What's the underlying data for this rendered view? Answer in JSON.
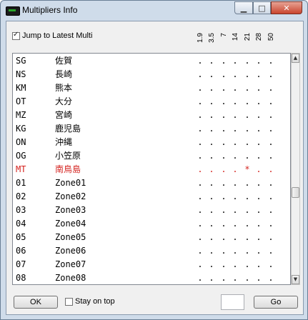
{
  "window": {
    "title": "Multipliers Info"
  },
  "options": {
    "jump_label": "Jump to Latest Multi",
    "jump_checked": true,
    "stay_label": "Stay on top",
    "stay_checked": false
  },
  "bands": [
    "1.9",
    "3.5",
    "7",
    "14",
    "21",
    "28",
    "50"
  ],
  "rows": [
    {
      "code": "SG",
      "name": "佐賀",
      "marks": [
        ".",
        ".",
        ".",
        ".",
        ".",
        ".",
        "."
      ],
      "highlight": false
    },
    {
      "code": "NS",
      "name": "長崎",
      "marks": [
        ".",
        ".",
        ".",
        ".",
        ".",
        ".",
        "."
      ],
      "highlight": false
    },
    {
      "code": "KM",
      "name": "熊本",
      "marks": [
        ".",
        ".",
        ".",
        ".",
        ".",
        ".",
        "."
      ],
      "highlight": false
    },
    {
      "code": "OT",
      "name": "大分",
      "marks": [
        ".",
        ".",
        ".",
        ".",
        ".",
        ".",
        "."
      ],
      "highlight": false
    },
    {
      "code": "MZ",
      "name": "宮崎",
      "marks": [
        ".",
        ".",
        ".",
        ".",
        ".",
        ".",
        "."
      ],
      "highlight": false
    },
    {
      "code": "KG",
      "name": "鹿児島",
      "marks": [
        ".",
        ".",
        ".",
        ".",
        ".",
        ".",
        "."
      ],
      "highlight": false
    },
    {
      "code": "ON",
      "name": "沖縄",
      "marks": [
        ".",
        ".",
        ".",
        ".",
        ".",
        ".",
        "."
      ],
      "highlight": false
    },
    {
      "code": "OG",
      "name": "小笠原",
      "marks": [
        ".",
        ".",
        ".",
        ".",
        ".",
        ".",
        "."
      ],
      "highlight": false
    },
    {
      "code": "MT",
      "name": "南鳥島",
      "marks": [
        ".",
        ".",
        ".",
        ".",
        "*",
        ".",
        "."
      ],
      "highlight": true
    },
    {
      "code": "01",
      "name": "Zone01",
      "marks": [
        ".",
        ".",
        ".",
        ".",
        ".",
        ".",
        "."
      ],
      "highlight": false
    },
    {
      "code": "02",
      "name": "Zone02",
      "marks": [
        ".",
        ".",
        ".",
        ".",
        ".",
        ".",
        "."
      ],
      "highlight": false
    },
    {
      "code": "03",
      "name": "Zone03",
      "marks": [
        ".",
        ".",
        ".",
        ".",
        ".",
        ".",
        "."
      ],
      "highlight": false
    },
    {
      "code": "04",
      "name": "Zone04",
      "marks": [
        ".",
        ".",
        ".",
        ".",
        ".",
        ".",
        "."
      ],
      "highlight": false
    },
    {
      "code": "05",
      "name": "Zone05",
      "marks": [
        ".",
        ".",
        ".",
        ".",
        ".",
        ".",
        "."
      ],
      "highlight": false
    },
    {
      "code": "06",
      "name": "Zone06",
      "marks": [
        ".",
        ".",
        ".",
        ".",
        ".",
        ".",
        "."
      ],
      "highlight": false
    },
    {
      "code": "07",
      "name": "Zone07",
      "marks": [
        ".",
        ".",
        ".",
        ".",
        ".",
        ".",
        "."
      ],
      "highlight": false
    },
    {
      "code": "08",
      "name": "Zone08",
      "marks": [
        ".",
        ".",
        ".",
        ".",
        ".",
        ".",
        "."
      ],
      "highlight": false
    }
  ],
  "buttons": {
    "ok": "OK",
    "go": "Go"
  },
  "go_input": {
    "value": ""
  },
  "colors": {
    "highlight": "#d4231f",
    "client_bg": "#f0f0f0"
  },
  "icons": {
    "app": "app-window-icon",
    "minimize": "minimize-icon",
    "maximize": "maximize-icon",
    "close": "close-icon",
    "scroll_up": "scroll-up-arrow-icon",
    "scroll_down": "scroll-down-arrow-icon"
  }
}
